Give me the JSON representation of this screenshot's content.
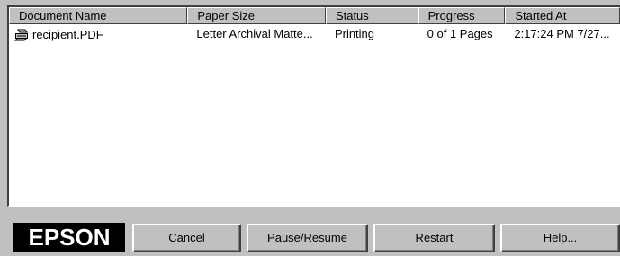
{
  "list": {
    "columns": [
      "Document Name",
      "Paper Size",
      "Status",
      "Progress",
      "Started At"
    ],
    "rows": [
      {
        "icon": "printer-document-icon",
        "document_name": "recipient.PDF",
        "paper_size": "Letter Archival Matte...",
        "status": "Printing",
        "progress": "0 of 1 Pages",
        "started_at": "2:17:24 PM 7/27..."
      }
    ]
  },
  "footer": {
    "logo_text": "EPSON",
    "buttons": {
      "cancel": {
        "mnemonic": "C",
        "rest": "ancel"
      },
      "pause_resume": {
        "mnemonic": "P",
        "rest": "ause/Resume"
      },
      "restart": {
        "mnemonic": "R",
        "rest": "estart"
      },
      "help": {
        "mnemonic": "H",
        "rest": "elp..."
      }
    }
  }
}
